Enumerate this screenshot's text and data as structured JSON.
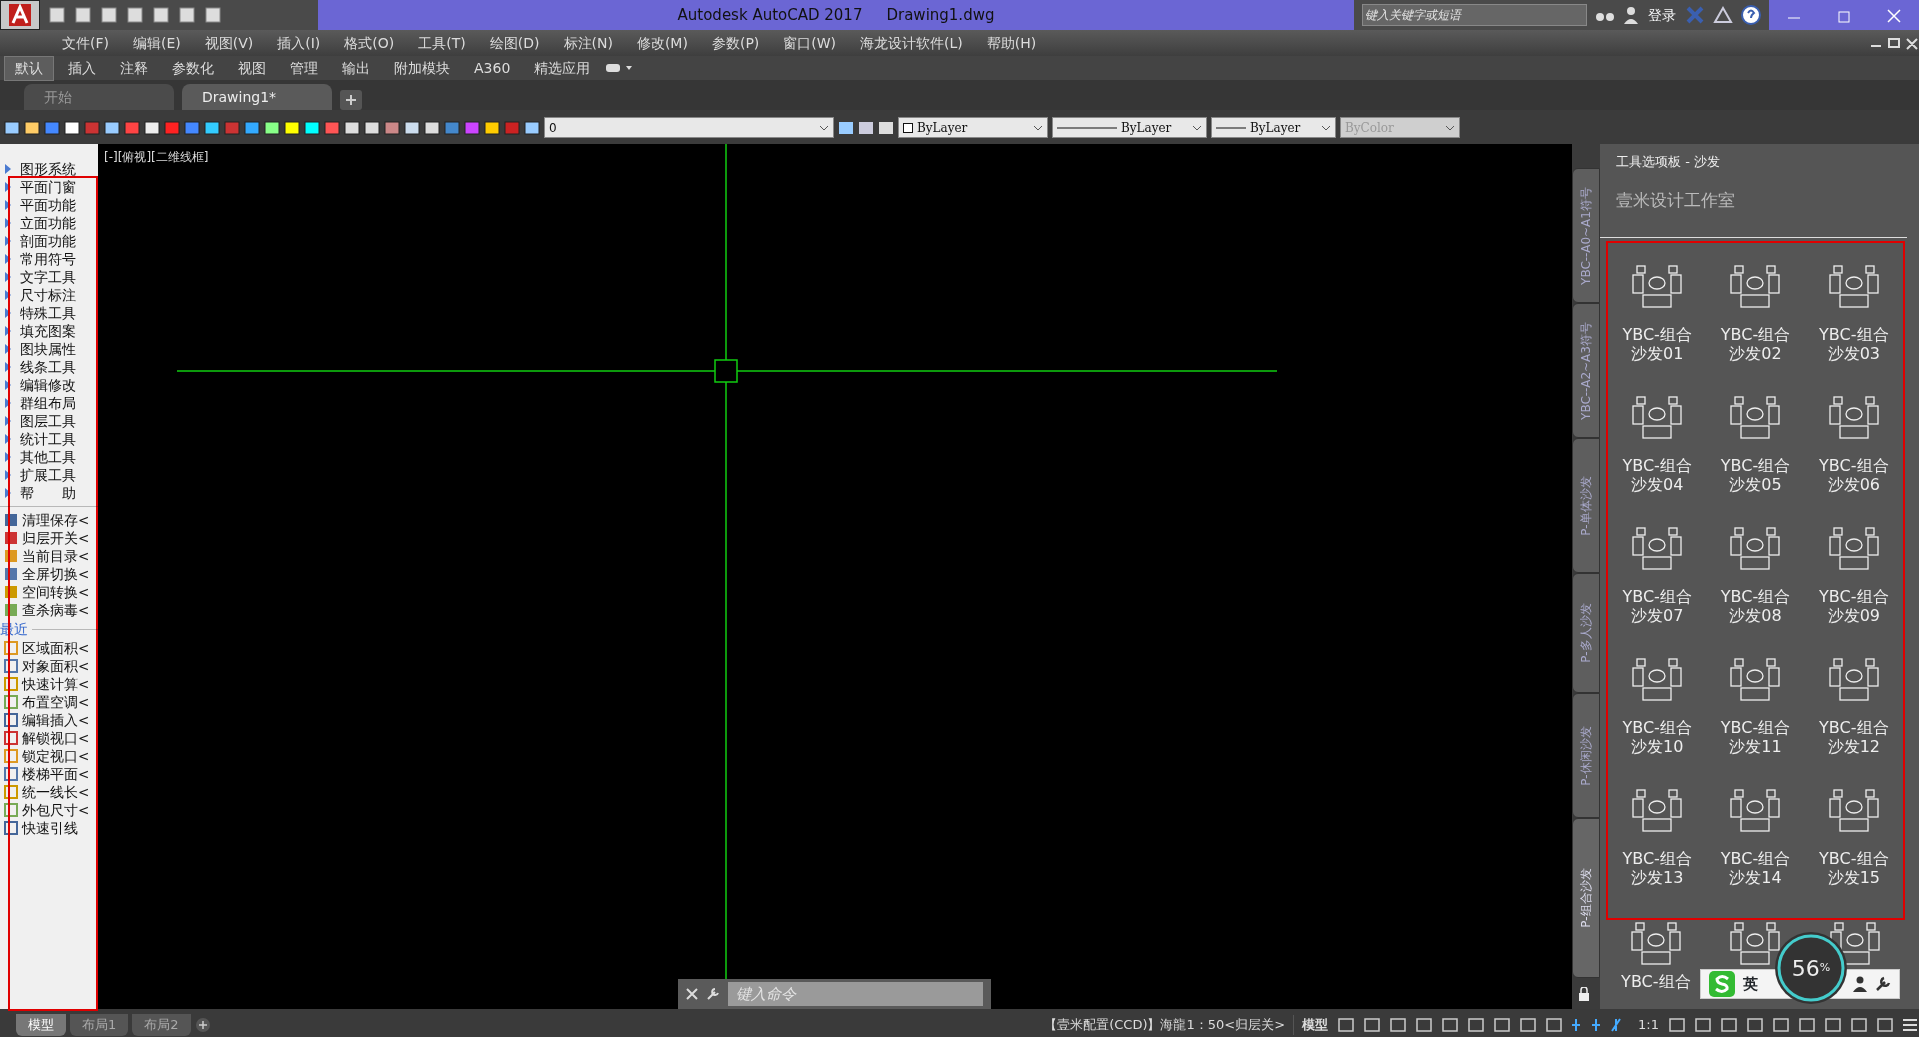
{
  "window": {
    "title": "Autodesk AutoCAD 2017",
    "document": "Drawing1.dwg",
    "search": {
      "placeholder": "键入关键字或短语"
    },
    "sign_in": "登录"
  },
  "menu": [
    "文件(F)",
    "编辑(E)",
    "视图(V)",
    "插入(I)",
    "格式(O)",
    "工具(T)",
    "绘图(D)",
    "标注(N)",
    "修改(M)",
    "参数(P)",
    "窗口(W)",
    "海龙设计软件(L)",
    "帮助(H)"
  ],
  "ribbon_tabs": [
    {
      "label": "默认",
      "selected": true
    },
    {
      "label": "插入",
      "selected": false
    },
    {
      "label": "注释",
      "selected": false
    },
    {
      "label": "参数化",
      "selected": false
    },
    {
      "label": "视图",
      "selected": false
    },
    {
      "label": "管理",
      "selected": false
    },
    {
      "label": "输出",
      "selected": false
    },
    {
      "label": "附加模块",
      "selected": false
    },
    {
      "label": "A360",
      "selected": false
    },
    {
      "label": "精选应用",
      "selected": false
    }
  ],
  "file_tabs": [
    {
      "label": "开始",
      "selected": false
    },
    {
      "label": "Drawing1*",
      "selected": true
    }
  ],
  "toolbar": {
    "layer": "0",
    "color_setting": "ByLayer",
    "linetype": "ByLayer",
    "lineweight": "ByLayer",
    "plot_style": {
      "value": "ByColor",
      "disabled": true
    }
  },
  "left_panel": {
    "menu_items": [
      "图形系统",
      "平面门窗",
      "平面功能",
      "立面功能",
      "剖面功能",
      "常用符号",
      "文字工具",
      "尺寸标注",
      "特殊工具",
      "填充图案",
      "图块属性",
      "线条工具",
      "编辑修改",
      "群组布局",
      "图层工具",
      "统计工具",
      "其他工具",
      "扩展工具",
      "帮　　助"
    ],
    "commands": [
      "清理保存<",
      "归层开关<",
      "当前目录<",
      "全屏切换<",
      "空间转换<",
      "查杀病毒<"
    ],
    "recent_heading": "最近",
    "recent": [
      "区域面积<",
      "对象面积<",
      "快速计算<",
      "布置空调<",
      "编辑插入<",
      "解锁视口<",
      "锁定视口<",
      "楼梯平面<",
      "统一线长<",
      "外包尺寸<",
      "快速引线"
    ]
  },
  "viewport": {
    "label": "[-][俯视][二维线框]",
    "command_line": {
      "placeholder": "键入命令"
    }
  },
  "palette": {
    "title": "工具选项板 - 沙发",
    "header": "壹米设计工作室",
    "side_tabs": [
      {
        "label": "YBC--A0~A1符号",
        "selected": false
      },
      {
        "label": "YBC--A2~A3符号",
        "selected": false
      },
      {
        "label": "P-单体沙发",
        "selected": false
      },
      {
        "label": "P-多人沙发",
        "selected": false
      },
      {
        "label": "P-休闲沙发",
        "selected": false
      },
      {
        "label": "P-组合沙发",
        "selected": true
      }
    ],
    "items": [
      {
        "label": "YBC-组合沙发01"
      },
      {
        "label": "YBC-组合沙发02"
      },
      {
        "label": "YBC-组合沙发03"
      },
      {
        "label": "YBC-组合沙发04"
      },
      {
        "label": "YBC-组合沙发05"
      },
      {
        "label": "YBC-组合沙发06"
      },
      {
        "label": "YBC-组合沙发07"
      },
      {
        "label": "YBC-组合沙发08"
      },
      {
        "label": "YBC-组合沙发09"
      },
      {
        "label": "YBC-组合沙发10"
      },
      {
        "label": "YBC-组合沙发11"
      },
      {
        "label": "YBC-组合沙发12"
      },
      {
        "label": "YBC-组合沙发13"
      },
      {
        "label": "YBC-组合沙发14"
      },
      {
        "label": "YBC-组合沙发15"
      }
    ],
    "partial_labels": [
      "YBC-组合"
    ]
  },
  "layout_tabs": [
    {
      "label": "模型",
      "selected": true
    },
    {
      "label": "布局1",
      "selected": false
    },
    {
      "label": "布局2",
      "selected": false
    }
  ],
  "status_bar": {
    "config": "【壹米配置(CCD)】海龍1：50<归层关>",
    "space": "模型",
    "scale": "1:1"
  },
  "ime_bar": {
    "language": "英",
    "meter_value": "56",
    "meter_unit": "%"
  }
}
